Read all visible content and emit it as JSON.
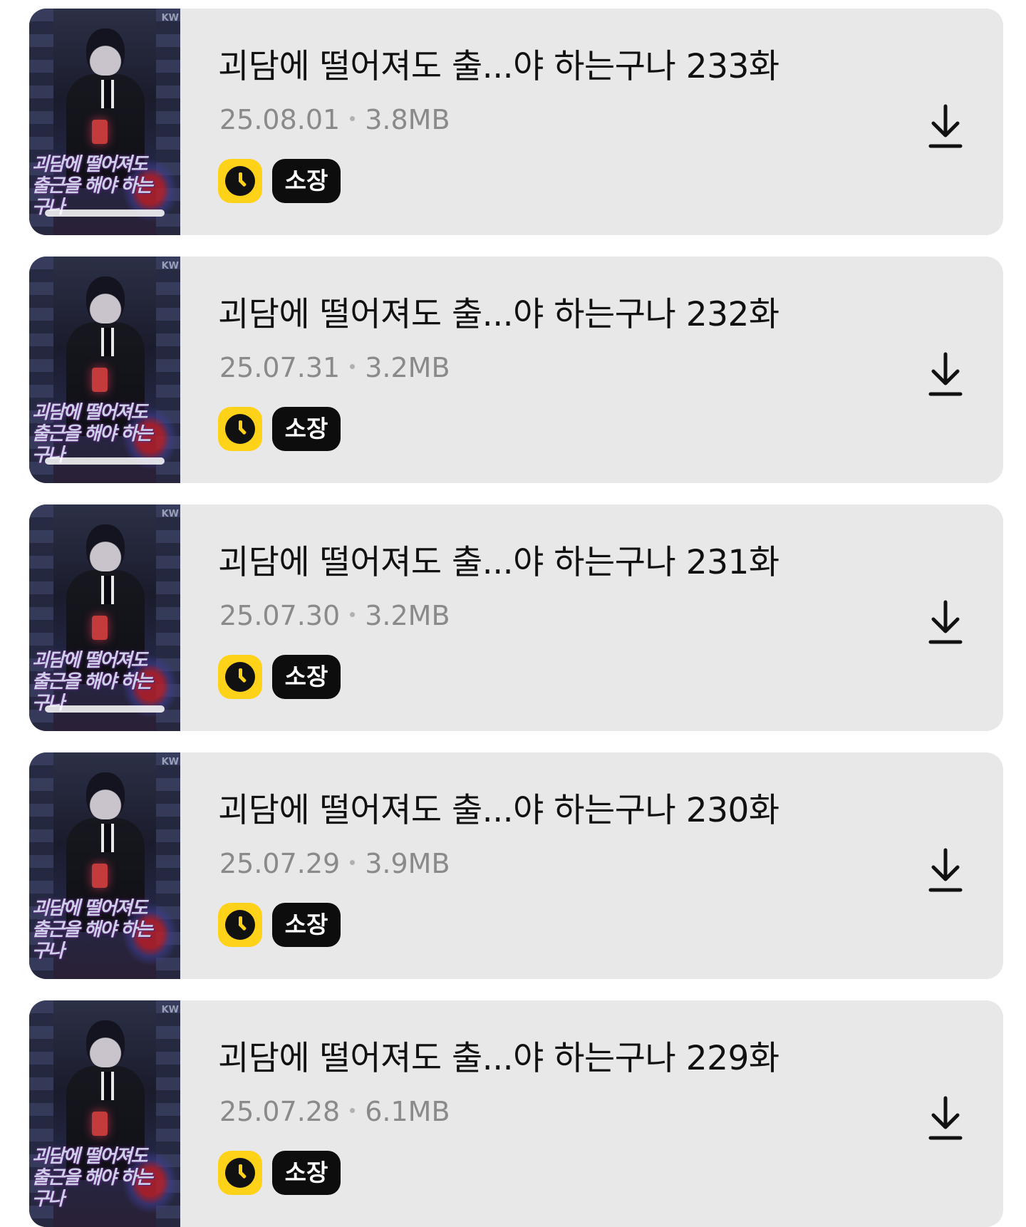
{
  "episodes": [
    {
      "title": "괴담에 떨어져도 출...야 하는구나 233화",
      "date": "25.08.01",
      "size": "3.8MB",
      "badge": "소장",
      "cover_label": "KW",
      "cover_title": "괴담에 떨어져도 출근을 해야 하는구나",
      "read_progress": 1.0
    },
    {
      "title": "괴담에 떨어져도 출...야 하는구나 232화",
      "date": "25.07.31",
      "size": "3.2MB",
      "badge": "소장",
      "cover_label": "KW",
      "cover_title": "괴담에 떨어져도 출근을 해야 하는구나",
      "read_progress": 1.0
    },
    {
      "title": "괴담에 떨어져도 출...야 하는구나 231화",
      "date": "25.07.30",
      "size": "3.2MB",
      "badge": "소장",
      "cover_label": "KW",
      "cover_title": "괴담에 떨어져도 출근을 해야 하는구나",
      "read_progress": 1.0
    },
    {
      "title": "괴담에 떨어져도 출...야 하는구나 230화",
      "date": "25.07.29",
      "size": "3.9MB",
      "badge": "소장",
      "cover_label": "KW",
      "cover_title": "괴담에 떨어져도 출근을 해야 하는구나",
      "read_progress": 0
    },
    {
      "title": "괴담에 떨어져도 출...야 하는구나 229화",
      "date": "25.07.28",
      "size": "6.1MB",
      "badge": "소장",
      "cover_label": "KW",
      "cover_title": "괴담에 떨어져도 출근을 해야 하는구나",
      "read_progress": 0
    }
  ],
  "icons": {
    "time_badge": "clock-icon",
    "download": "download-icon"
  },
  "colors": {
    "card_background": "#e8e8e8",
    "time_badge": "#ffd21a",
    "own_badge": "#0d0d0d",
    "meta_text": "#8a8a8a"
  }
}
